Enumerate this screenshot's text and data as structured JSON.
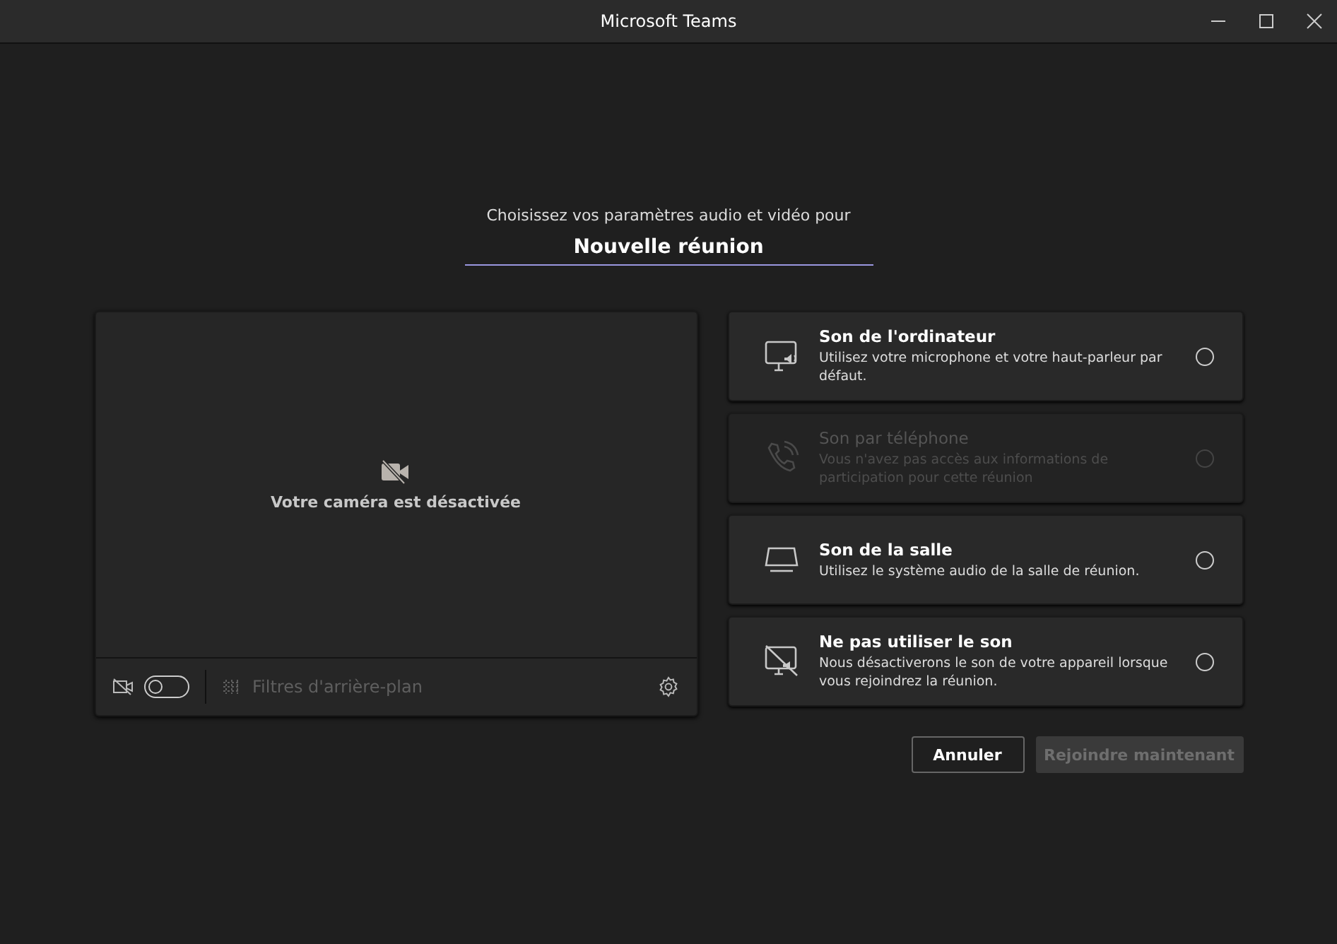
{
  "window": {
    "title": "Microsoft Teams"
  },
  "heading": "Choisissez vos paramètres audio et vidéo pour",
  "meeting_name": {
    "value": "Nouvelle réunion"
  },
  "camera": {
    "status_text": "Votre caméra est désactivée",
    "on": false
  },
  "background_filters": {
    "label": "Filtres d'arrière-plan",
    "disabled": true
  },
  "audio_options": [
    {
      "kind": "computer",
      "title": "Son de l'ordinateur",
      "description": "Utilisez votre microphone et votre haut-parleur par défaut.",
      "selected": false,
      "disabled": false
    },
    {
      "kind": "phone",
      "title": "Son par téléphone",
      "description": "Vous n'avez pas accès aux informations de participation pour cette réunion",
      "selected": false,
      "disabled": true
    },
    {
      "kind": "room",
      "title": "Son de la salle",
      "description": "Utilisez le système audio de la salle de réunion.",
      "selected": false,
      "disabled": false
    },
    {
      "kind": "none",
      "title": "Ne pas utiliser le son",
      "description": "Nous désactiverons le son de votre appareil lorsque vous rejoindrez la réunion.",
      "selected": false,
      "disabled": false
    }
  ],
  "buttons": [
    {
      "kind": "secondary",
      "label": "Annuler",
      "disabled": false
    },
    {
      "kind": "primary",
      "label": "Rejoindre maintenant",
      "disabled": true
    }
  ]
}
